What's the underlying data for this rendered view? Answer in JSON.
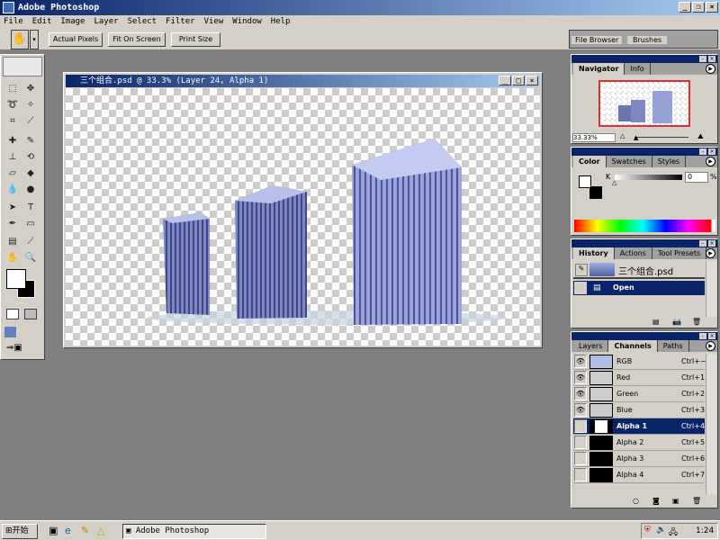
{
  "app": {
    "title": "Adobe Photoshop"
  },
  "menu": [
    "File",
    "Edit",
    "Image",
    "Layer",
    "Select",
    "Filter",
    "View",
    "Window",
    "Help"
  ],
  "options": {
    "actual_pixels": "Actual Pixels",
    "fit_on_screen": "Fit On Screen",
    "print_size": "Print Size"
  },
  "palette_well": {
    "tabs": [
      "File Browser",
      "Brushes"
    ]
  },
  "document": {
    "title": "三个组合.psd @ 33.3% (Layer 24, Alpha 1)"
  },
  "navigator": {
    "tabs": [
      "Navigator",
      "Info"
    ],
    "zoom": "33.33%"
  },
  "color": {
    "tabs": [
      "Color",
      "Swatches",
      "Styles"
    ],
    "channel_label": "K",
    "value": "0",
    "unit": "%"
  },
  "history": {
    "tabs": [
      "History",
      "Actions",
      "Tool Presets"
    ],
    "snapshot": "三个组合.psd",
    "items": [
      "Open"
    ]
  },
  "channels": {
    "tabs": [
      "Layers",
      "Channels",
      "Paths"
    ],
    "rows": [
      {
        "name": "RGB",
        "key": "Ctrl+~",
        "visible": true
      },
      {
        "name": "Red",
        "key": "Ctrl+1",
        "visible": true
      },
      {
        "name": "Green",
        "key": "Ctrl+2",
        "visible": true
      },
      {
        "name": "Blue",
        "key": "Ctrl+3",
        "visible": true
      },
      {
        "name": "Alpha 1",
        "key": "Ctrl+4",
        "visible": false,
        "selected": true
      },
      {
        "name": "Alpha 2",
        "key": "Ctrl+5",
        "visible": false
      },
      {
        "name": "Alpha 3",
        "key": "Ctrl+6",
        "visible": false
      },
      {
        "name": "Alpha 4",
        "key": "Ctrl+7",
        "visible": false
      }
    ]
  },
  "taskbar": {
    "start": "开始",
    "task": "Adobe Photoshop",
    "clock": "1:24"
  }
}
